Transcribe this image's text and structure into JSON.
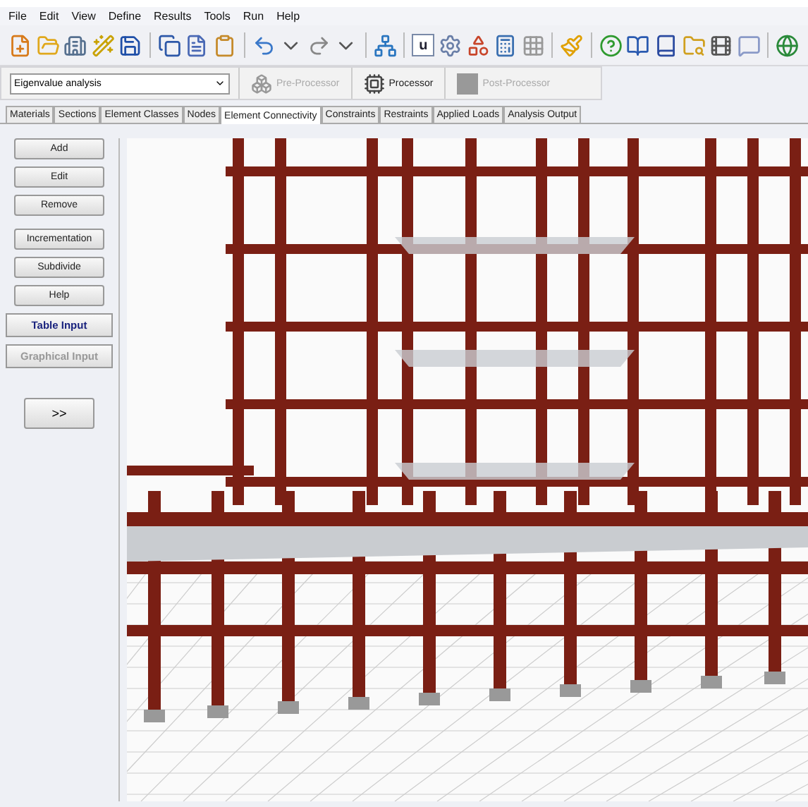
{
  "menu": [
    "File",
    "Edit",
    "View",
    "Define",
    "Results",
    "Tools",
    "Run",
    "Help"
  ],
  "toolbar": {
    "text_button": "u"
  },
  "analysis": {
    "value": "Eigenvalue analysis"
  },
  "stages": [
    {
      "label": "Pre-Processor",
      "disabled": true
    },
    {
      "label": "Processor",
      "disabled": false
    },
    {
      "label": "Post-Processor",
      "disabled": true
    }
  ],
  "tabs": [
    {
      "label": "Materials",
      "selected": false
    },
    {
      "label": "Sections",
      "selected": false
    },
    {
      "label": "Element Classes",
      "selected": false
    },
    {
      "label": "Nodes",
      "selected": false
    },
    {
      "label": "Element Connectivity",
      "selected": true
    },
    {
      "label": "Constraints",
      "selected": false
    },
    {
      "label": "Restraints",
      "selected": false
    },
    {
      "label": "Applied Loads",
      "selected": false
    },
    {
      "label": "Analysis Output",
      "selected": false
    }
  ],
  "side_buttons": [
    {
      "label": "Add",
      "kind": "plain"
    },
    {
      "label": "Edit",
      "kind": "plain"
    },
    {
      "label": "Remove",
      "kind": "plain"
    },
    {
      "label": "Incrementation",
      "kind": "group_start"
    },
    {
      "label": "Subdivide",
      "kind": "plain"
    },
    {
      "label": "Help",
      "kind": "plain"
    },
    {
      "label": "Table Input",
      "kind": "mode",
      "disabled": false
    },
    {
      "label": "Graphical Input",
      "kind": "mode",
      "disabled": true
    }
  ],
  "expand_button": ">>"
}
